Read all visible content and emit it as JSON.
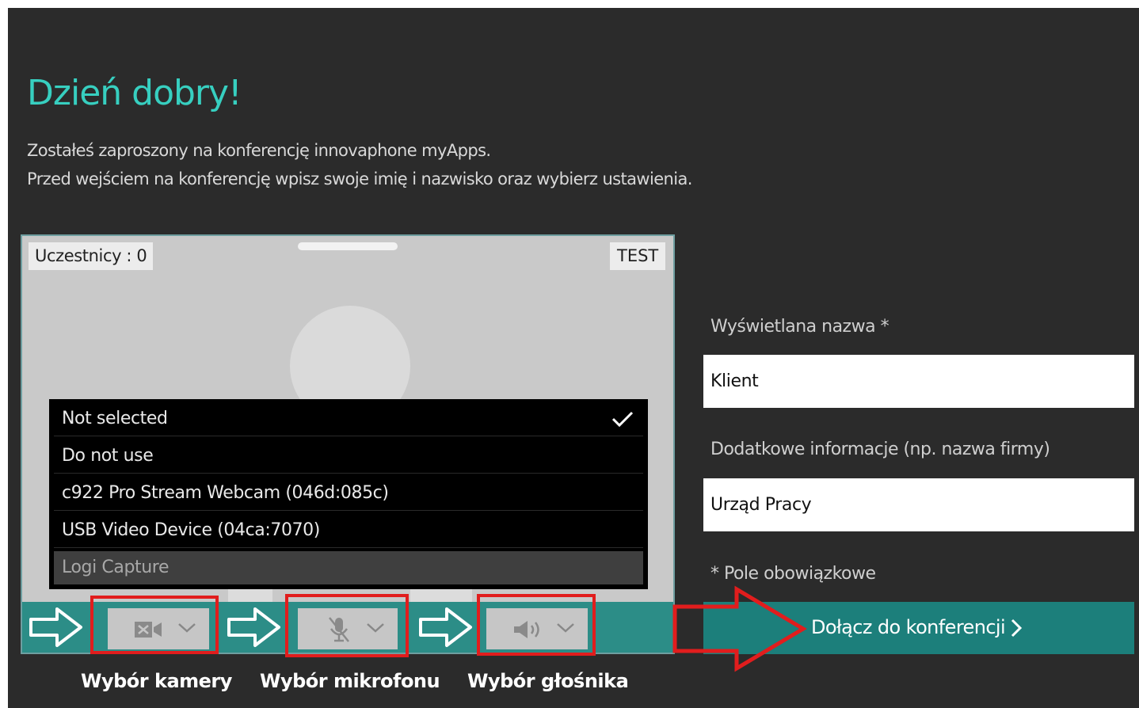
{
  "header": {
    "greeting": "Dzień dobry!",
    "intro_line1": "Zostałeś zaproszony na konferencję innovaphone myApps.",
    "intro_line2": "Przed wejściem na konferencję wpisz swoje imię i nazwisko oraz wybierz ustawienia."
  },
  "video_panel": {
    "participants": "Uczestnicy : 0",
    "test_button": "TEST"
  },
  "camera_dropdown": {
    "options": [
      {
        "label": "Not selected",
        "selected": true
      },
      {
        "label": "Do not use"
      },
      {
        "label": "c922 Pro Stream Webcam (046d:085c)"
      },
      {
        "label": "USB Video Device (04ca:7070)"
      },
      {
        "label": "Logi Capture",
        "disabled": true
      }
    ]
  },
  "toolbar": {
    "camera_icon": "camera-off-icon",
    "mic_icon": "microphone-off-icon",
    "speaker_icon": "speaker-icon"
  },
  "captions": {
    "camera": "Wybór kamery",
    "microphone": "Wybór mikrofonu",
    "speaker": "Wybór głośnika"
  },
  "form": {
    "display_name_label": "Wyświetlana nazwa *",
    "display_name_value": "Klient",
    "extra_info_label": "Dodatkowe informacje (np. nazwa firmy)",
    "extra_info_value": "Urząd Pracy",
    "required_note": "* Pole obowiązkowe",
    "join_button": "Dołącz do konferencji"
  },
  "colors": {
    "background": "#2b2b2b",
    "accent": "#37cfc0",
    "join_button": "#1c7f7b",
    "toolbar": "#2c8d87",
    "annotation_red": "#e11d1d"
  }
}
